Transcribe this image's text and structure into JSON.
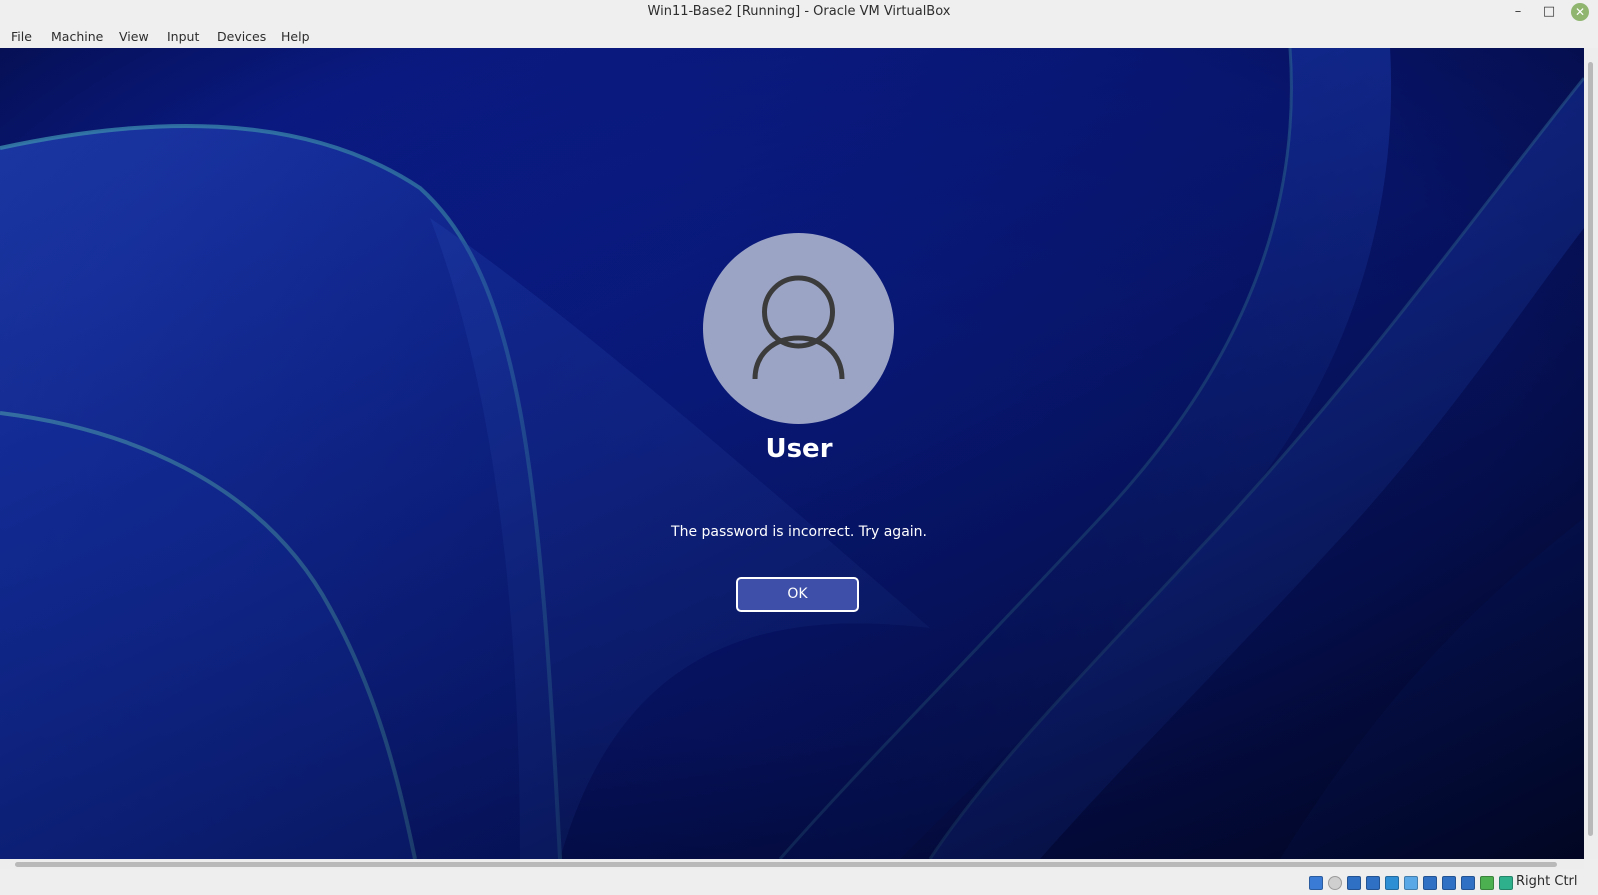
{
  "window": {
    "title": "Win11-Base2 [Running] - Oracle VM VirtualBox",
    "controls": {
      "minimize": "–",
      "maximize": "□",
      "close": "✕"
    }
  },
  "menu": {
    "items": [
      "File",
      "Machine",
      "View",
      "Input",
      "Devices",
      "Help"
    ]
  },
  "login": {
    "user_name": "User",
    "message": "The password is incorrect. Try again.",
    "ok_label": "OK"
  },
  "statusbar": {
    "host_key": "Right Ctrl",
    "icons": [
      {
        "name": "hard-disk-icon",
        "color": "#3a7bd5"
      },
      {
        "name": "optical-drive-icon",
        "color": "#cfcfcf"
      },
      {
        "name": "audio-icon",
        "color": "#2f6fc4"
      },
      {
        "name": "network-icon",
        "color": "#2f6fc4"
      },
      {
        "name": "usb-icon",
        "color": "#2f8fd4"
      },
      {
        "name": "shared-folders-icon",
        "color": "#5aa9e6"
      },
      {
        "name": "display-icon",
        "color": "#2f6fc4"
      },
      {
        "name": "video-capture-icon",
        "color": "#2f6fc4"
      },
      {
        "name": "cpu-icon",
        "color": "#2f6fc4"
      },
      {
        "name": "mouse-integration-icon",
        "color": "#4caf50"
      },
      {
        "name": "keyboard-capture-icon",
        "color": "#2fb08c"
      }
    ]
  },
  "colors": {
    "wallpaper_base": "#0a1d8a",
    "avatar_bg": "#9ca4c6",
    "ok_button_bg": "#3d4fa8"
  }
}
